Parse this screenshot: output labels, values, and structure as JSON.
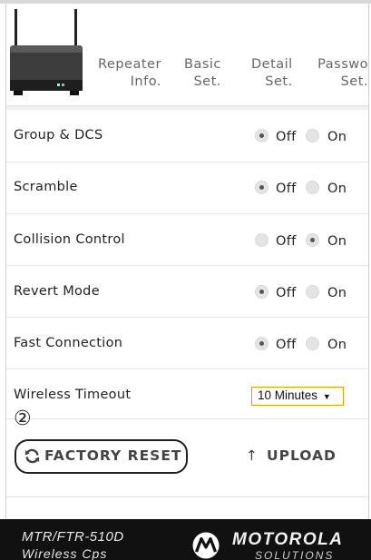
{
  "nav": {
    "tabs": [
      {
        "line1": "Repeater",
        "line2": "Info."
      },
      {
        "line1": "Basic",
        "line2": "Set."
      },
      {
        "line1": "Detail",
        "line2": "Set."
      },
      {
        "line1": "Passwo",
        "line2": "Set."
      }
    ]
  },
  "settings": [
    {
      "label": "Group & DCS",
      "off_label": "Off",
      "on_label": "On",
      "selected": "Off"
    },
    {
      "label": "Scramble",
      "off_label": "Off",
      "on_label": "On",
      "selected": "Off"
    },
    {
      "label": "Collision Control",
      "off_label": "Off",
      "on_label": "On",
      "selected": "On"
    },
    {
      "label": "Revert Mode",
      "off_label": "Off",
      "on_label": "On",
      "selected": "Off"
    },
    {
      "label": "Fast Connection",
      "off_label": "Off",
      "on_label": "On",
      "selected": "Off"
    }
  ],
  "wireless_timeout": {
    "label": "Wireless Timeout",
    "value": "10 Minutes",
    "caret": "▼"
  },
  "annotation": {
    "marker": "②"
  },
  "actions": {
    "factory_reset": "FACTORY RESET",
    "upload": "UPLOAD",
    "upload_arrow": "↑",
    "reset_icon": "refresh-icon"
  },
  "footer": {
    "model": "MTR/FTR-510D",
    "subtitle": "Wireless Cps",
    "brand": "MOTOROLA",
    "brand_sub": "SOLUTIONS"
  },
  "colors": {
    "accent_border": "#e0a000",
    "footer_bg": "#111111"
  }
}
